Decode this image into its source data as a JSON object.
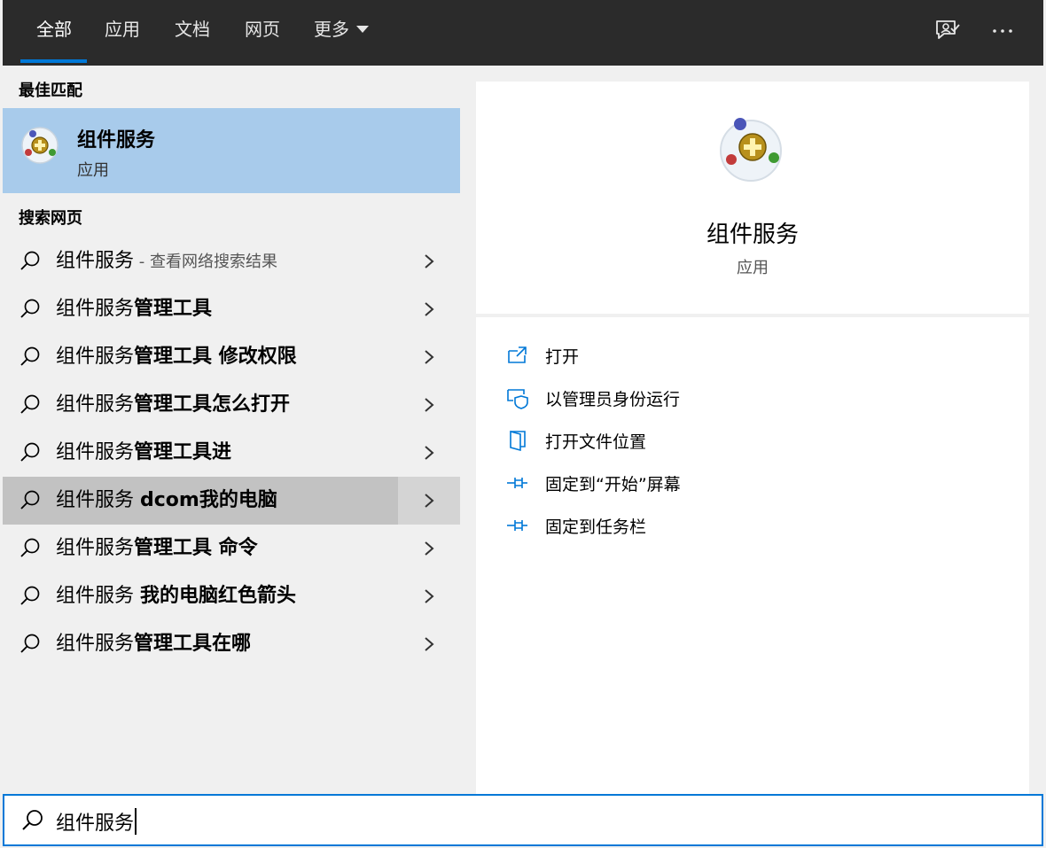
{
  "tabs": [
    {
      "label": "全部",
      "active": true
    },
    {
      "label": "应用"
    },
    {
      "label": "文档"
    },
    {
      "label": "网页"
    },
    {
      "label": "更多"
    }
  ],
  "top_icons": [
    "feedback-icon",
    "more-icon"
  ],
  "best_match": {
    "section_label": "最佳匹配",
    "title": "组件服务",
    "subtitle": "应用",
    "icon": "component-services-icon"
  },
  "web_search": {
    "section_label": "搜索网页",
    "rows": [
      {
        "prefix": "组件服务",
        "bold": "",
        "hint": " - 查看网络搜索结果"
      },
      {
        "prefix": "组件服务",
        "bold": "管理工具",
        "hint": ""
      },
      {
        "prefix": "组件服务",
        "bold": "管理工具 修改权限",
        "hint": ""
      },
      {
        "prefix": "组件服务",
        "bold": "管理工具怎么打开",
        "hint": ""
      },
      {
        "prefix": "组件服务",
        "bold": "管理工具进",
        "hint": ""
      },
      {
        "prefix": "组件服务 ",
        "bold": "dcom我的电脑",
        "hint": ""
      },
      {
        "prefix": "组件服务",
        "bold": "管理工具 命令",
        "hint": ""
      },
      {
        "prefix": "组件服务 ",
        "bold": "我的电脑红色箭头",
        "hint": ""
      },
      {
        "prefix": "组件服务",
        "bold": "管理工具在哪",
        "hint": ""
      }
    ]
  },
  "preview": {
    "title": "组件服务",
    "subtitle": "应用",
    "actions": [
      {
        "label": "打开",
        "icon": "open-icon"
      },
      {
        "label": "以管理员身份运行",
        "icon": "shield-icon"
      },
      {
        "label": "打开文件位置",
        "icon": "file-location-icon"
      },
      {
        "label": "固定到“开始”屏幕",
        "icon": "pin-icon"
      },
      {
        "label": "固定到任务栏",
        "icon": "pin-icon"
      }
    ]
  },
  "search": {
    "value": "组件服务"
  },
  "colors": {
    "topbar": "#2b2b2b",
    "accent": "#0078d7",
    "selected": "#a8cbeb",
    "hover": "#c2c2c2"
  }
}
